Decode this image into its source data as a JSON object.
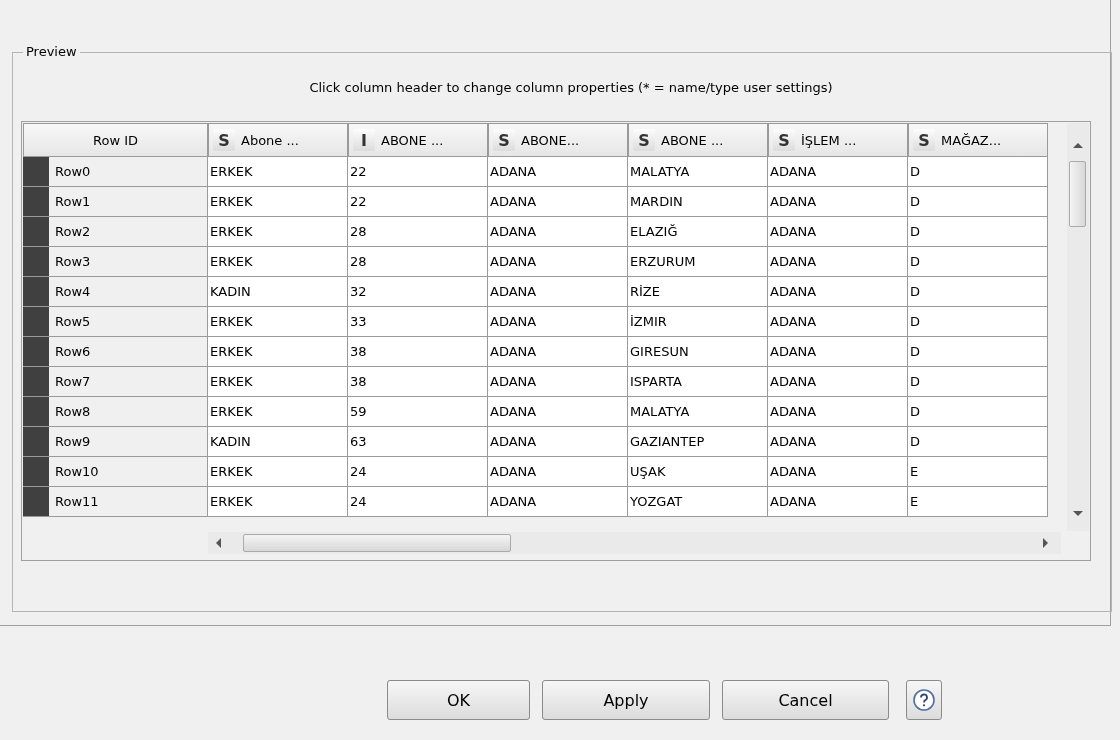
{
  "preview": {
    "legend": "Preview",
    "hint": "Click column header to change column properties (* = name/type user settings)",
    "table": {
      "row_id_header": "Row ID",
      "columns": [
        {
          "type_icon": "S",
          "label": "Abone ..."
        },
        {
          "type_icon": "I",
          "label": "ABONE ..."
        },
        {
          "type_icon": "S",
          "label": "ABONE..."
        },
        {
          "type_icon": "S",
          "label": "ABONE ..."
        },
        {
          "type_icon": "S",
          "label": "İŞLEM ..."
        },
        {
          "type_icon": "S",
          "label": "MAĞAZ..."
        }
      ],
      "rows": [
        {
          "id": "Row0",
          "cells": [
            "ERKEK",
            "22",
            "ADANA",
            "MALATYA",
            "ADANA",
            "D"
          ]
        },
        {
          "id": "Row1",
          "cells": [
            "ERKEK",
            "22",
            "ADANA",
            "MARDIN",
            "ADANA",
            "D"
          ]
        },
        {
          "id": "Row2",
          "cells": [
            "ERKEK",
            "28",
            "ADANA",
            "ELAZIĞ",
            "ADANA",
            "D"
          ]
        },
        {
          "id": "Row3",
          "cells": [
            "ERKEK",
            "28",
            "ADANA",
            "ERZURUM",
            "ADANA",
            "D"
          ]
        },
        {
          "id": "Row4",
          "cells": [
            "KADIN",
            "32",
            "ADANA",
            "RİZE",
            "ADANA",
            "D"
          ]
        },
        {
          "id": "Row5",
          "cells": [
            "ERKEK",
            "33",
            "ADANA",
            "İZMIR",
            "ADANA",
            "D"
          ]
        },
        {
          "id": "Row6",
          "cells": [
            "ERKEK",
            "38",
            "ADANA",
            "GIRESUN",
            "ADANA",
            "D"
          ]
        },
        {
          "id": "Row7",
          "cells": [
            "ERKEK",
            "38",
            "ADANA",
            "ISPARTA",
            "ADANA",
            "D"
          ]
        },
        {
          "id": "Row8",
          "cells": [
            "ERKEK",
            "59",
            "ADANA",
            "MALATYA",
            "ADANA",
            "D"
          ]
        },
        {
          "id": "Row9",
          "cells": [
            "KADIN",
            "63",
            "ADANA",
            "GAZIANTEP",
            "ADANA",
            "D"
          ]
        },
        {
          "id": "Row10",
          "cells": [
            "ERKEK",
            "24",
            "ADANA",
            "UŞAK",
            "ADANA",
            "E"
          ]
        },
        {
          "id": "Row11",
          "cells": [
            "ERKEK",
            "24",
            "ADANA",
            "YOZGAT",
            "ADANA",
            "E"
          ]
        }
      ]
    }
  },
  "buttons": [
    {
      "label": "OK"
    },
    {
      "label": "Apply"
    },
    {
      "label": "Cancel"
    }
  ]
}
